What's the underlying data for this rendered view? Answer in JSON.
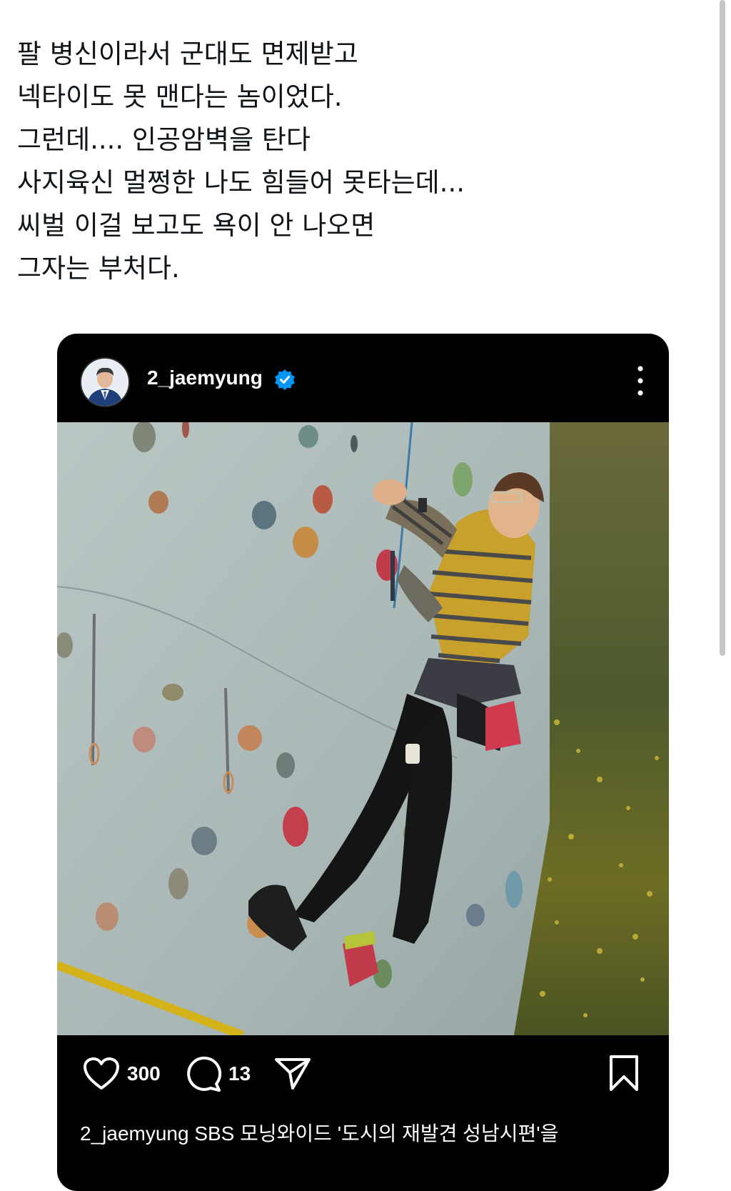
{
  "post": {
    "lines": [
      "팔 병신이라서 군대도 면제받고",
      "넥타이도 못 맨다는 놈이었다.",
      "그런데.... 인공암벽을 탄다",
      "사지육신 멀쩡한 나도 힘들어 못타는데...",
      "씨벌 이걸 보고도 욕이 안 나오면",
      "그자는 부처다."
    ]
  },
  "embed": {
    "username": "2_jaemyung",
    "verified_icon": "verified-badge-icon",
    "more_icon": "more-vertical-icon",
    "likes": "300",
    "comments": "13",
    "caption_peek": "2_jaemyung SBS 모닝와이드 '도시의 재발견 성남시편'을",
    "colors": {
      "background": "#000000",
      "verified": "#0095f6",
      "text": "#ffffff"
    }
  }
}
